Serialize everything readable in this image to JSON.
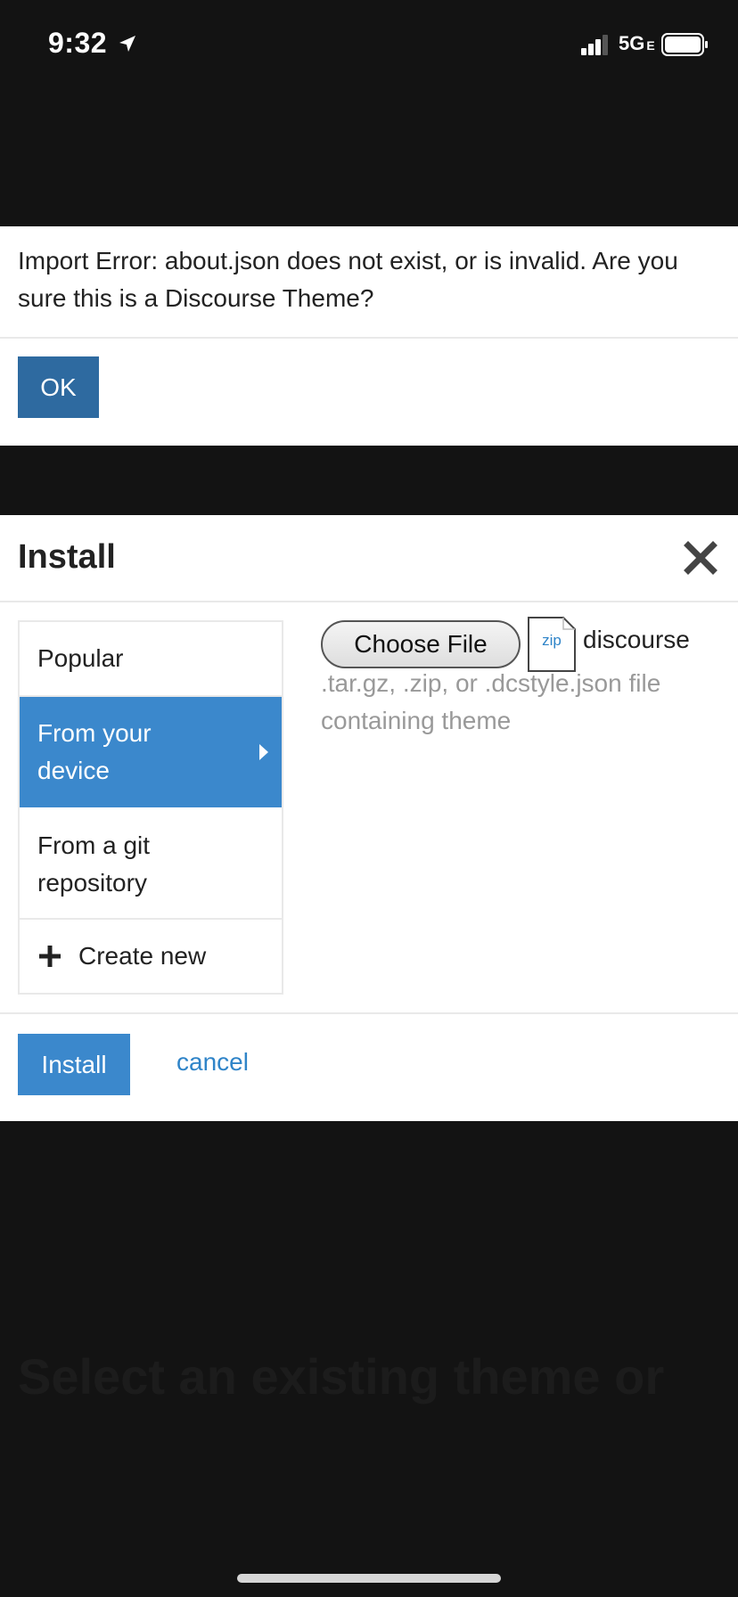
{
  "status_bar": {
    "time": "9:32",
    "network": "5G",
    "network_suffix": "E"
  },
  "error_dialog": {
    "message": "Import Error: about.json does not exist, or is invalid. Are you sure this is a Discourse Theme?",
    "ok_label": "OK"
  },
  "install_modal": {
    "title": "Install",
    "nav": [
      {
        "label": "Popular",
        "selected": false
      },
      {
        "label": "From your device",
        "selected": true
      },
      {
        "label": "From a git repository",
        "selected": false
      },
      {
        "label": "Create new",
        "selected": false
      }
    ],
    "file_input": {
      "button_label": "Choose File",
      "file_type_badge": "zip",
      "file_name": "discourse",
      "hint": ".tar.gz, .zip, or .dcstyle.json file containing theme"
    },
    "install_label": "Install",
    "cancel_label": "cancel"
  },
  "background": {
    "ghost_heading": "Select an existing theme or"
  },
  "colors": {
    "primary": "#3b88cc",
    "primary_dark": "#2e6aa0",
    "overlay": "#131313"
  }
}
